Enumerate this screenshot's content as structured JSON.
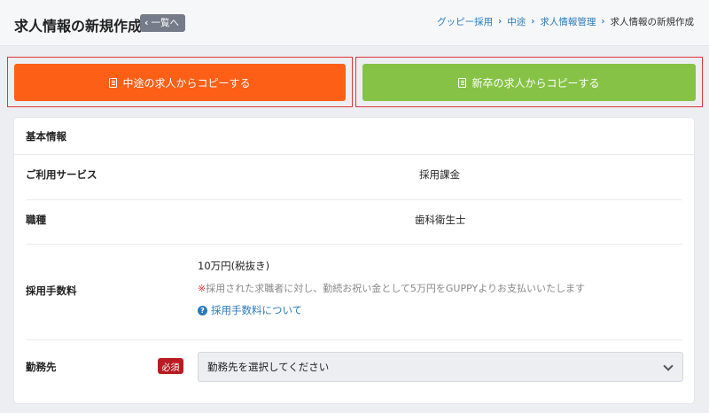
{
  "header": {
    "title": "求人情報の新規作成",
    "back_label": "一覧へ",
    "breadcrumb": [
      "グッピー採用",
      "中途",
      "求人情報管理",
      "求人情報の新規作成"
    ]
  },
  "copy_buttons": {
    "mid_career": "中途の求人からコピーする",
    "new_grad": "新卒の求人からコピーする"
  },
  "card": {
    "title": "基本情報",
    "service": {
      "label": "ご利用サービス",
      "value": "採用課金"
    },
    "job_type": {
      "label": "職種",
      "value": "歯科衛生士"
    },
    "fee": {
      "label": "採用手数料",
      "amount": "10万円(税抜き)",
      "note_mark": "※",
      "note": "採用された求職者に対し、勤続お祝い金として5万円をGUPPYよりお支払いいたします",
      "link": "採用手数料について"
    },
    "workplace": {
      "label": "勤務先",
      "required": "必須",
      "placeholder": "勤務先を選択してください"
    }
  },
  "colors": {
    "mid_career_button": "#fd5f17",
    "new_grad_button": "#86c245",
    "required_badge": "#b81c22",
    "link": "#2a7ab8",
    "highlight_frame": "#e0353a"
  }
}
